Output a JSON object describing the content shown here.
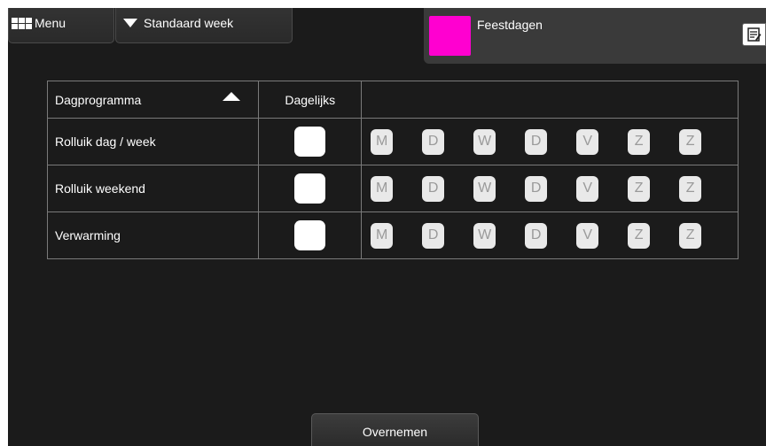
{
  "toolbar": {
    "menu_label": "Menu",
    "week_select_label": "Standaard week"
  },
  "holidays": {
    "label": "Feestdagen",
    "swatch_color": "#ff00d0"
  },
  "table": {
    "headers": {
      "name": "Dagprogramma",
      "daily": "Dagelijks"
    },
    "sort": "ascending",
    "rows": [
      {
        "name": "Rolluik dag / week",
        "daily": false,
        "days": [
          "M",
          "D",
          "W",
          "D",
          "V",
          "Z",
          "Z"
        ]
      },
      {
        "name": "Rolluik weekend",
        "daily": false,
        "days": [
          "M",
          "D",
          "W",
          "D",
          "V",
          "Z",
          "Z"
        ]
      },
      {
        "name": "Verwarming",
        "daily": false,
        "days": [
          "M",
          "D",
          "W",
          "D",
          "V",
          "Z",
          "Z"
        ]
      }
    ]
  },
  "footer": {
    "apply_label": "Overnemen"
  },
  "icons": [
    "grid-menu-icon",
    "triangle-down-icon",
    "sort-ascending-icon",
    "edit-list-icon"
  ]
}
